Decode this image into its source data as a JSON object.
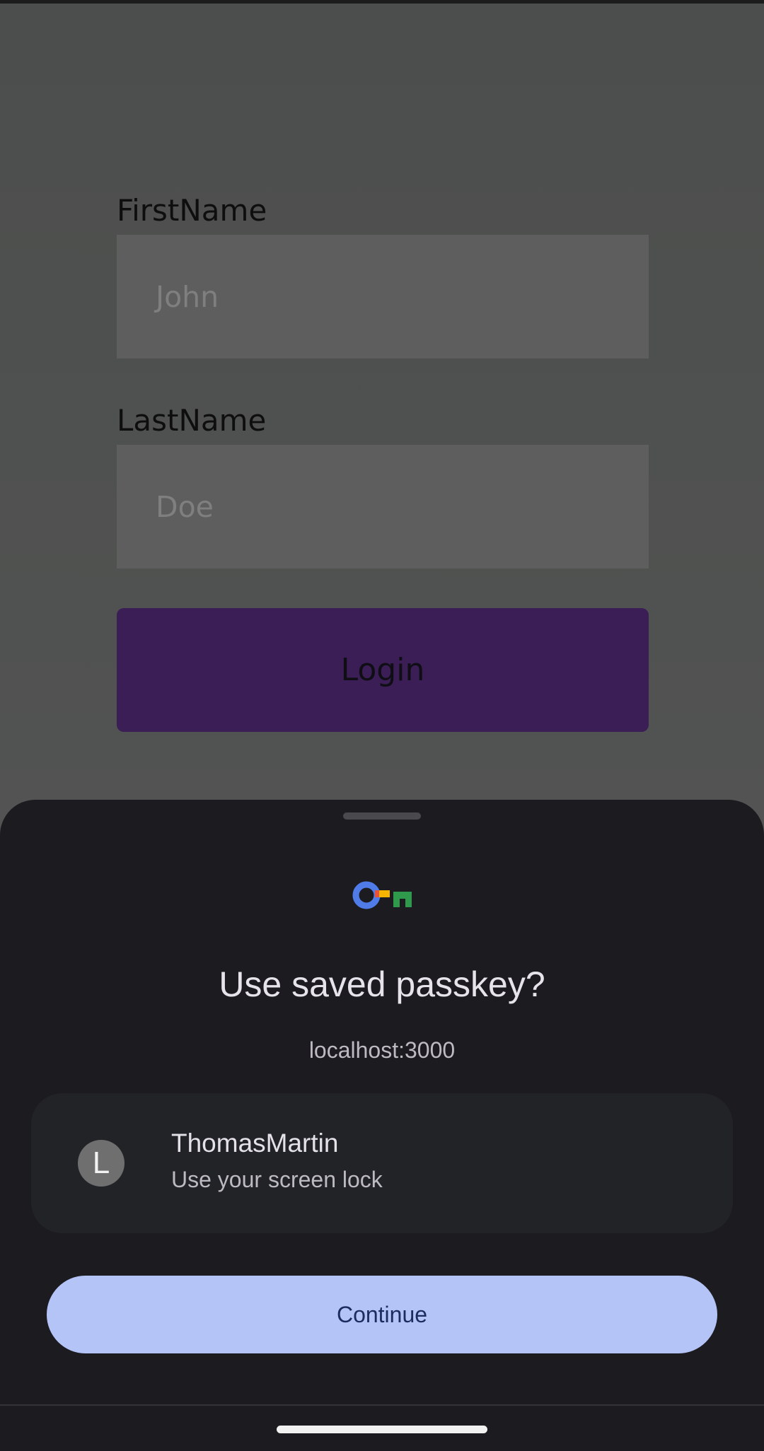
{
  "form": {
    "first_name_label": "FirstName",
    "first_name_placeholder": "John",
    "last_name_label": "LastName",
    "last_name_placeholder": "Doe",
    "login_label": "Login"
  },
  "passkey_sheet": {
    "icon": "passkey-key-icon",
    "title": "Use saved passkey?",
    "origin": "localhost:3000",
    "account": {
      "avatar_letter": "L",
      "username": "ThomasMartin",
      "method": "Use your screen lock"
    },
    "continue_label": "Continue"
  },
  "colors": {
    "login_button": "#3b1e55",
    "sheet_background": "#1c1b20",
    "continue_button": "#b4c4f7",
    "continue_text": "#1d2c5e"
  }
}
